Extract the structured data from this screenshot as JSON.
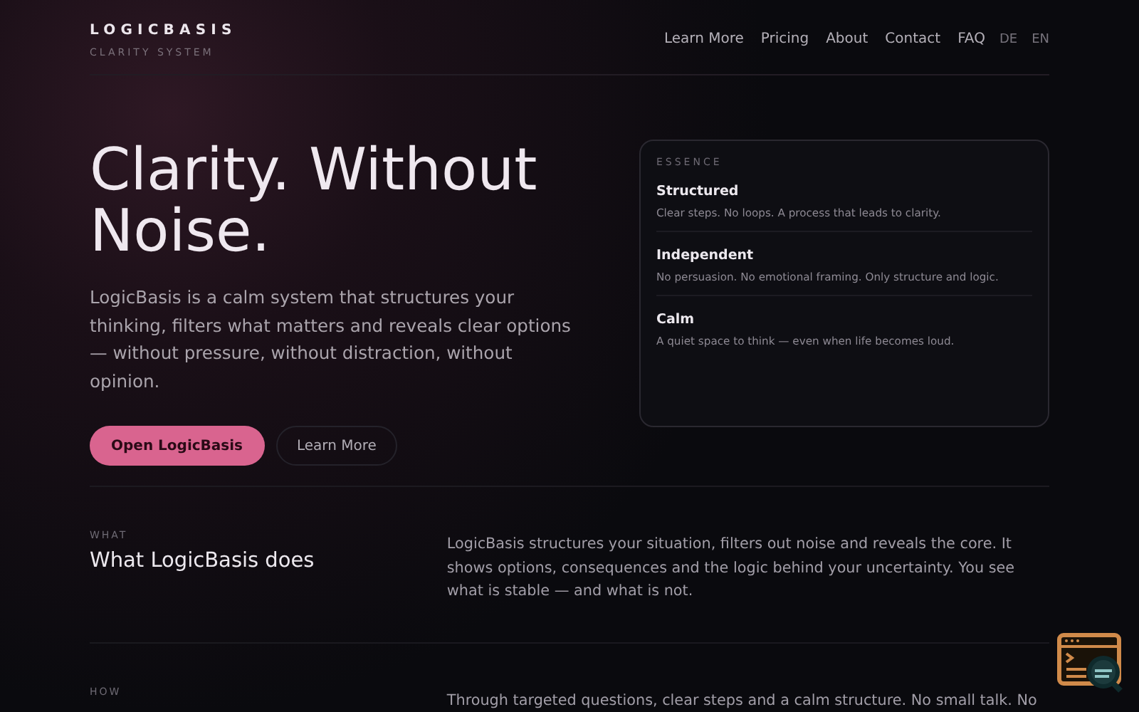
{
  "brand": {
    "name": "LOGICBASIS",
    "tagline": "CLARITY SYSTEM"
  },
  "nav": {
    "links": [
      "Learn More",
      "Pricing",
      "About",
      "Contact",
      "FAQ"
    ],
    "languages": [
      {
        "label": "DE",
        "selected": false
      },
      {
        "label": "EN",
        "selected": false
      }
    ]
  },
  "hero": {
    "heading": "Clarity. Without Noise.",
    "text": "LogicBasis is a calm system that structures your thinking, filters what matters and reveals clear options — without pressure, without distraction, without opinion.",
    "buttons": [
      {
        "label": "Open LogicBasis",
        "kind": "primary"
      },
      {
        "label": "Learn More",
        "kind": "secondary"
      }
    ]
  },
  "essence": {
    "label": "ESSENCE",
    "items": [
      {
        "title": "Structured",
        "text": "Clear steps. No loops. A process that leads to clarity."
      },
      {
        "title": "Independent",
        "text": "No persuasion. No emotional framing. Only structure and logic."
      },
      {
        "title": "Calm",
        "text": "A quiet space to think — even when life becomes loud."
      }
    ]
  },
  "sections": [
    {
      "label": "WHAT",
      "heading": "What LogicBasis does",
      "text": "LogicBasis structures your situation, filters out noise and reveals the core. It shows options, consequences and the logic behind your uncertainty. You see what is stable — and what is not."
    },
    {
      "label": "HOW",
      "text": "Through targeted questions, clear steps and a calm structure. No small talk. No"
    }
  ]
}
